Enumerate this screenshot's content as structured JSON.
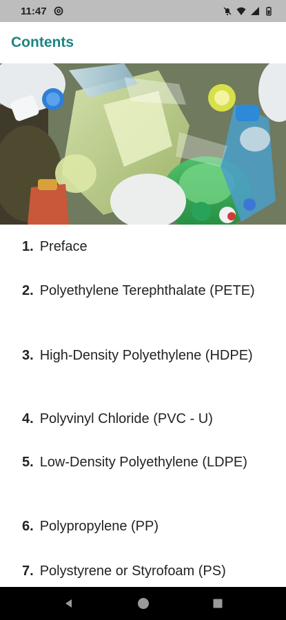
{
  "status_bar": {
    "time": "11:47",
    "icons": [
      "at-sign-icon",
      "notifications-off-icon",
      "wifi-icon",
      "signal-icon",
      "battery-icon"
    ]
  },
  "app_bar": {
    "title": "Contents",
    "accent_color": "#1b8580"
  },
  "hero_image": {
    "subject": "pile of plastic bottles and waste"
  },
  "contents": {
    "items": [
      {
        "number": "1.",
        "label": "Preface"
      },
      {
        "number": "2.",
        "label": "Polyethylene Terephthalate (PETE)"
      },
      {
        "number": "3.",
        "label": "High-Density Polyethylene (HDPE)"
      },
      {
        "number": "4.",
        "label": "Polyvinyl Chloride (PVC - U)"
      },
      {
        "number": "5.",
        "label": "Low-Density Polyethylene (LDPE)"
      },
      {
        "number": "6.",
        "label": "Polypropylene (PP)"
      },
      {
        "number": "7.",
        "label": "Polystyrene or Styrofoam (PS)"
      }
    ]
  },
  "nav_bar": {
    "buttons": [
      "back-icon",
      "home-icon",
      "recents-icon"
    ]
  }
}
